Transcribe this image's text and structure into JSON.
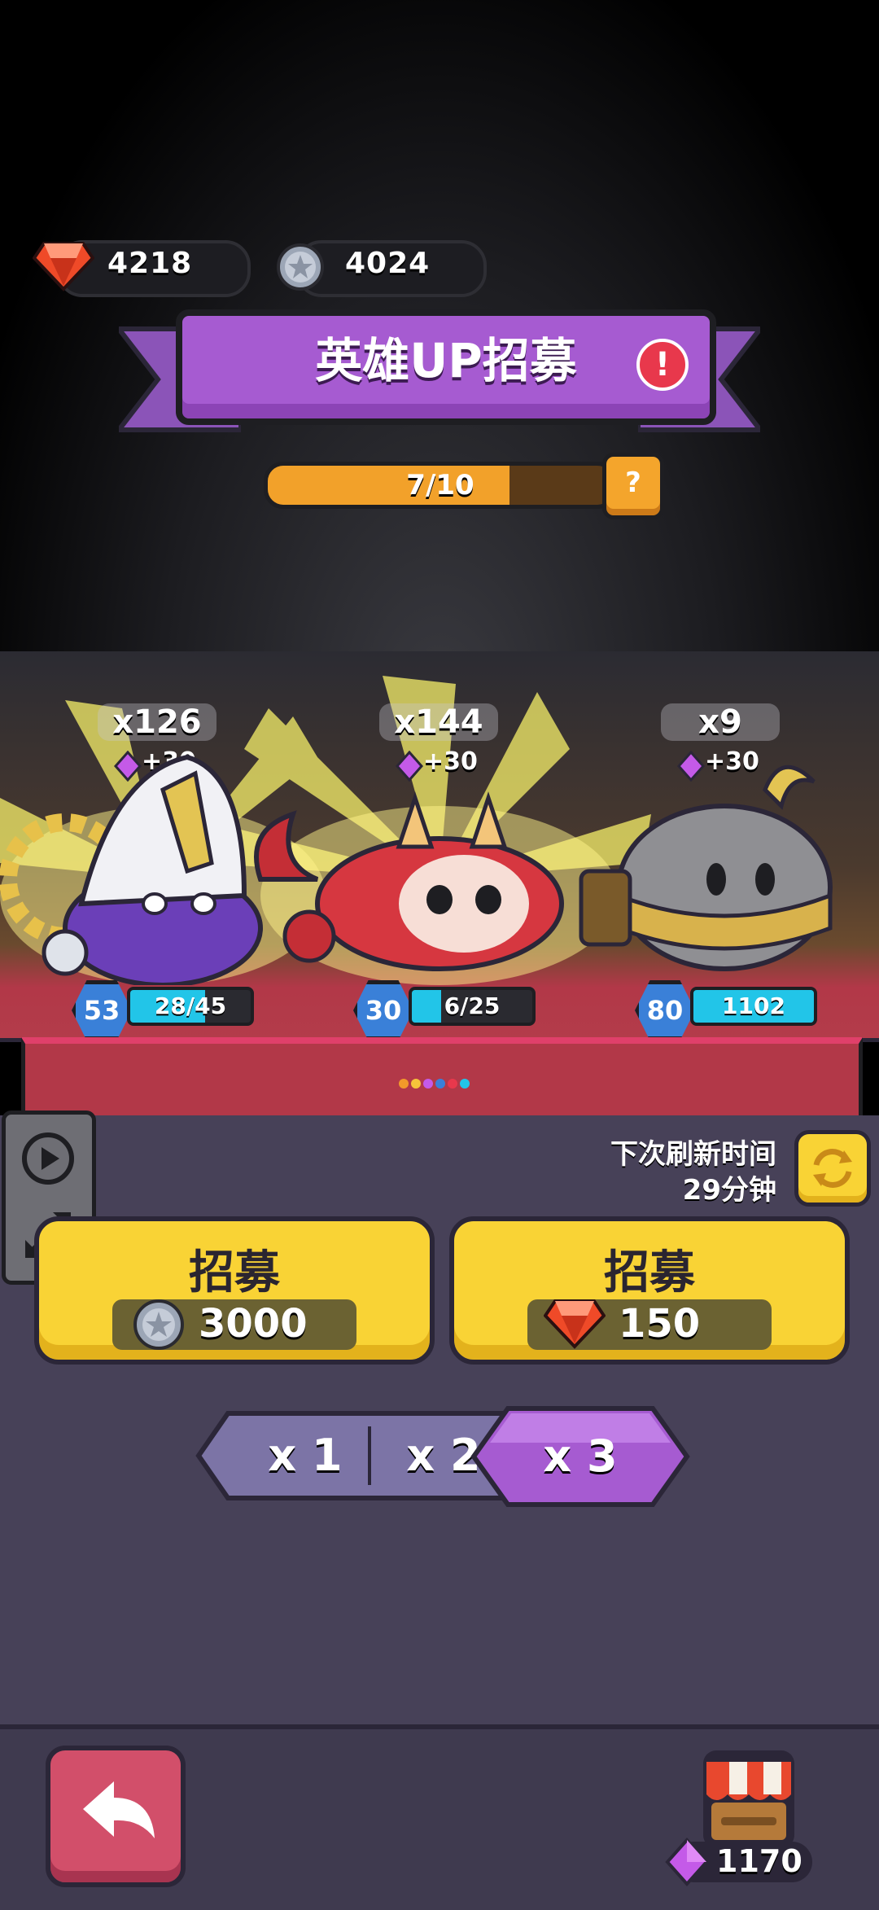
{
  "currencies": {
    "gems": "4218",
    "coins": "4024"
  },
  "banner": {
    "title": "英雄UP招募",
    "alert": "!"
  },
  "progress": {
    "text": "7/10",
    "value": 0.7,
    "help": "?"
  },
  "heroes": [
    {
      "count": "x126",
      "bonus": "+30",
      "level": "53",
      "xp_text": "28/45",
      "xp_fill": 0.62
    },
    {
      "count": "x144",
      "bonus": "+30",
      "level": "30",
      "xp_text": "6/25",
      "xp_fill": 0.24
    },
    {
      "count": "x9",
      "bonus": "+30",
      "level": "80",
      "xp_text": "1102",
      "xp_fill": 1.0
    }
  ],
  "refresh": {
    "label": "下次刷新时间",
    "time": "29分钟"
  },
  "recruit": [
    {
      "label": "招募",
      "cost": "3000",
      "currency": "coin"
    },
    {
      "label": "招募",
      "cost": "150",
      "currency": "gem"
    }
  ],
  "multipliers": {
    "options": [
      "x 1",
      "x 2",
      "x 3"
    ],
    "selected": "x 3"
  },
  "shop": {
    "gems": "1170"
  },
  "colors": {
    "accent_purple": "#a65bd1",
    "button_yellow": "#f9d335",
    "back_red": "#d24f6a"
  }
}
